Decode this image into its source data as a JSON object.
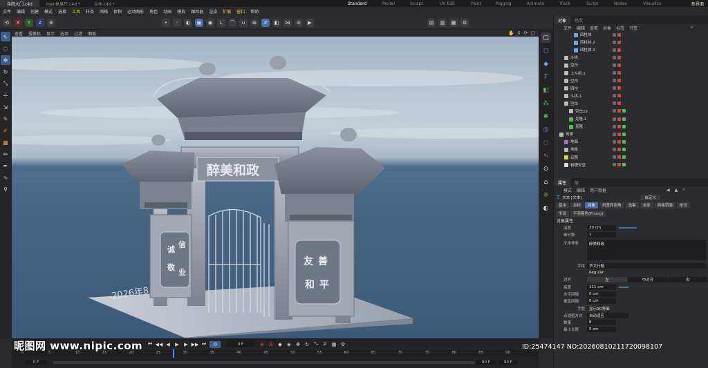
{
  "tabs": {
    "documents": [
      "寺院大门.c4d",
      "men休息厅.c4d *",
      "兰州.c4d *"
    ],
    "layouts": [
      "Standard",
      "Model",
      "Sculpt",
      "UV Edit",
      "Paint",
      "Rigging",
      "Animate",
      "Track",
      "Script",
      "Nodes",
      "Visualize"
    ],
    "new_layout": "新界面"
  },
  "menu": [
    "文件",
    "编辑",
    "创建",
    "模式",
    "选择",
    "工具",
    "样条",
    "网格",
    "体积",
    "运动图形",
    "角色",
    "动画",
    "模拟",
    "跟踪器",
    "渲染",
    "扩展",
    "窗口",
    "帮助"
  ],
  "toolbar": {
    "axes": [
      "X",
      "Y",
      "Z"
    ]
  },
  "viewport": {
    "menu": [
      "查看",
      "摄像机",
      "显示",
      "选项",
      "过滤",
      "面板"
    ],
    "sign": "醉美和政",
    "left_panel": [
      "诚",
      "信",
      "敬",
      "业"
    ],
    "right_panel": [
      "友",
      "善",
      "和",
      "平"
    ],
    "base_text": "2026年8月10日制作"
  },
  "objects_panel": {
    "tabs": [
      "对象",
      "场次"
    ],
    "menu": [
      "文件",
      "编辑",
      "查看",
      "对象",
      "标签",
      "书签"
    ],
    "rows": [
      {
        "name": "四柱体",
        "indent": 3
      },
      {
        "name": "四柱体.2",
        "indent": 3
      },
      {
        "name": "四柱体.3",
        "indent": 3
      },
      {
        "name": "斗拱",
        "indent": 1
      },
      {
        "name": "空白",
        "indent": 1
      },
      {
        "name": "上斗拱.1",
        "indent": 1
      },
      {
        "name": "空白",
        "indent": 1
      },
      {
        "name": "四柱",
        "indent": 1
      },
      {
        "name": "斗拱.1",
        "indent": 1
      },
      {
        "name": "空白",
        "indent": 1
      },
      {
        "name": "空白22",
        "indent": 2
      },
      {
        "name": "克隆.1",
        "indent": 2
      },
      {
        "name": "克隆",
        "indent": 2
      },
      {
        "name": "地面",
        "indent": 0
      },
      {
        "name": "地面",
        "indent": 1
      },
      {
        "name": "地板",
        "indent": 1
      },
      {
        "name": "日照",
        "indent": 1
      },
      {
        "name": "物理天空",
        "indent": 1
      }
    ]
  },
  "attributes_panel": {
    "tabs": [
      "属性",
      "层"
    ],
    "menu": [
      "模式",
      "编辑",
      "用户数据"
    ],
    "object_label": "文本 [文本]",
    "custom": "自定义",
    "sub_tabs": [
      "基本",
      "坐标",
      "对象",
      "封盖和倒角",
      "选集",
      "全部",
      "网格范围",
      "单词"
    ],
    "sub_tabs2": [
      "字母",
      "平滑着色(Phong)"
    ],
    "section": "对象属性",
    "props": {
      "depth_label": "深度",
      "depth": "20 cm",
      "subdiv_label": "细分数",
      "subdiv": "1",
      "text_label": "文本样条",
      "text": "醉美和政",
      "font_label": "字体",
      "font": "华文行楷",
      "style": "Regular",
      "align_label": "对齐",
      "align_left": "左",
      "align_center": "中对齐",
      "align_right": "右",
      "height_label": "高度",
      "height": "111 cm",
      "hspace_label": "水平间隔",
      "hspace": "0 cm",
      "vspace_label": "垂直间隔",
      "vspace": "0 cm",
      "kerning_label": "字距",
      "kerning": "显示3D界面",
      "point_label": "点插值方式",
      "point": "自动适应",
      "count_label": "数量",
      "count": "8",
      "min_label": "最小长度",
      "min": "5 cm"
    }
  },
  "timeline": {
    "frame": "3 F",
    "ticks": [
      "0",
      "5",
      "10",
      "15",
      "20",
      "25",
      "30",
      "35",
      "40",
      "45",
      "50",
      "55",
      "60",
      "65",
      "70",
      "75",
      "80",
      "85",
      "90"
    ],
    "start": "0 F",
    "end_a": "90 F",
    "end_b": "90 F",
    "end_c": "0 F"
  },
  "watermark": {
    "left": "昵图网 www.nipic.com",
    "right": "ID:25474147 NO:20260810211720098107"
  }
}
